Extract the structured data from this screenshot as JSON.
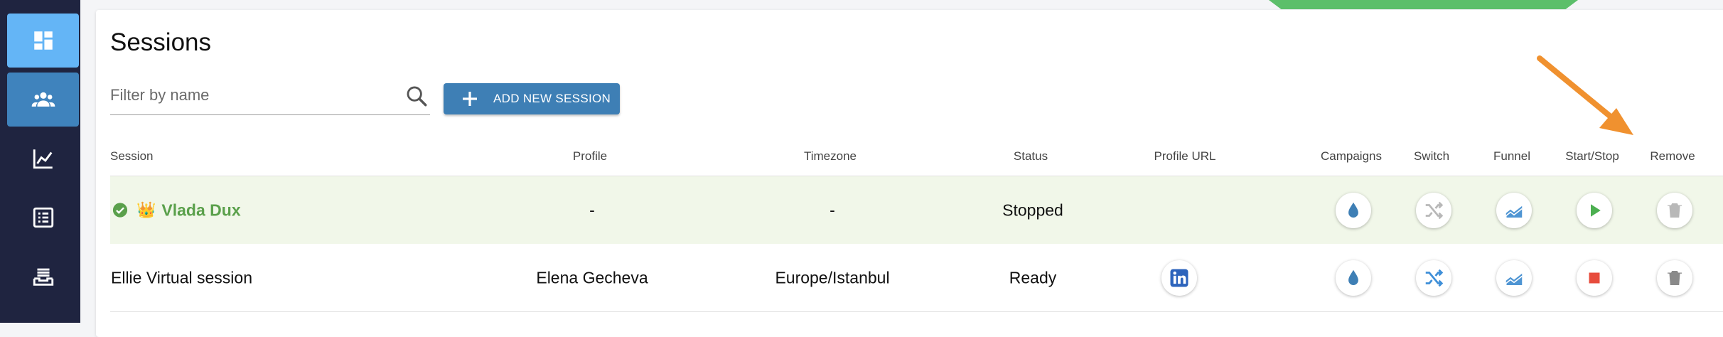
{
  "page": {
    "title": "Sessions"
  },
  "colors": {
    "accent": "#3e7fb5",
    "sidebar": "#1f2440",
    "success": "#5aa04b",
    "danger": "#e74c3c",
    "annotation_arrow": "#f0912f"
  },
  "sidebar": {
    "items": [
      {
        "icon": "dashboard-icon",
        "state": "active"
      },
      {
        "icon": "people-icon",
        "state": "selected"
      },
      {
        "icon": "chart-line-icon",
        "state": "normal"
      },
      {
        "icon": "list-icon",
        "state": "normal"
      },
      {
        "icon": "inbox-icon",
        "state": "normal"
      }
    ]
  },
  "search": {
    "placeholder": "Filter by name",
    "value": ""
  },
  "toolbar": {
    "add_label": "ADD NEW SESSION"
  },
  "table": {
    "headers": [
      "Session",
      "Profile",
      "Timezone",
      "Status",
      "Profile URL",
      "Campaigns",
      "Switch",
      "Funnel",
      "Start/Stop",
      "Remove"
    ],
    "rows": [
      {
        "session": "Vlada Dux",
        "session_emoji": "👑",
        "active": true,
        "profile": "-",
        "timezone": "-",
        "status": "Stopped",
        "has_profile_url": false,
        "switch_enabled": false,
        "start_stop": "play"
      },
      {
        "session": "Ellie Virtual session",
        "session_emoji": "",
        "active": false,
        "profile": "Elena Gecheva",
        "timezone": "Europe/Istanbul",
        "status": "Ready",
        "has_profile_url": true,
        "switch_enabled": true,
        "start_stop": "stop"
      }
    ]
  }
}
